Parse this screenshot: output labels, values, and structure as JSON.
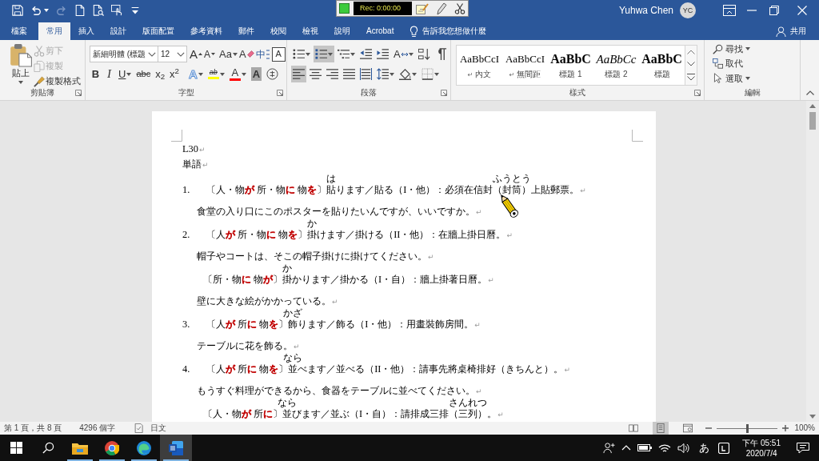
{
  "title_bar": {
    "quick_access": [
      {
        "kind": "save",
        "disabled": false
      },
      {
        "kind": "undo",
        "disabled": false,
        "dropdown": true
      },
      {
        "kind": "redo",
        "disabled": true
      },
      {
        "kind": "new",
        "disabled": false
      },
      {
        "kind": "preview",
        "disabled": false
      },
      {
        "kind": "touch",
        "disabled": false
      },
      {
        "kind": "customize",
        "disabled": false
      }
    ],
    "recorder": {
      "time": "Rec: 0:00:00"
    },
    "user": {
      "name": "Yuhwa Chen",
      "initials": "YC"
    }
  },
  "tabs": [
    {
      "label": "檔案",
      "selected": false
    },
    {
      "label": "常用",
      "selected": true
    },
    {
      "label": "插入",
      "selected": false
    },
    {
      "label": "設計",
      "selected": false
    },
    {
      "label": "版面配置",
      "selected": false
    },
    {
      "label": "參考資料",
      "selected": false
    },
    {
      "label": "郵件",
      "selected": false
    },
    {
      "label": "校閱",
      "selected": false
    },
    {
      "label": "檢視",
      "selected": false
    },
    {
      "label": "說明",
      "selected": false
    },
    {
      "label": "Acrobat",
      "selected": false
    }
  ],
  "tell_me": {
    "placeholder": "告訴我您想做什麼"
  },
  "share": {
    "label": "共用"
  },
  "ribbon": {
    "clipboard": {
      "title": "剪貼簿",
      "paste": "貼上",
      "items": [
        {
          "kind": "cut",
          "label": "剪下",
          "disabled": true
        },
        {
          "kind": "copy",
          "label": "複製",
          "disabled": true
        },
        {
          "kind": "format_painter",
          "label": "複製格式",
          "disabled": false
        }
      ]
    },
    "font": {
      "title": "字型",
      "font_name": "新細明體 (標題",
      "font_size": "12",
      "row_1": [
        {
          "kind": "grow",
          "text": "A"
        },
        {
          "kind": "shrink",
          "text": "A"
        },
        {
          "kind": "change_case",
          "text": "Aa",
          "dropdown": true
        },
        {
          "kind": "clear_format",
          "text": "A"
        },
        {
          "kind": "phonetic",
          "text": "中"
        },
        {
          "kind": "char_border",
          "text": "A"
        }
      ],
      "row_2": [
        {
          "kind": "bold",
          "text": "B"
        },
        {
          "kind": "italic",
          "text": "I"
        },
        {
          "kind": "underline",
          "text": "U",
          "dropdown": true
        },
        {
          "kind": "strike",
          "text": "abc"
        },
        {
          "kind": "subscript",
          "text": "x$_{2}$"
        },
        {
          "kind": "superscript",
          "text": "x$^{2}$"
        },
        {
          "kind": "text_effects",
          "text": "A",
          "dropdown": true
        },
        {
          "kind": "highlight",
          "text": "ab",
          "color": "#ffff00",
          "dropdown": true
        },
        {
          "kind": "font_color",
          "text": "A",
          "color": "#ff0000",
          "dropdown": true
        },
        {
          "kind": "char_shading",
          "text": "A"
        },
        {
          "kind": "enclosed"
        }
      ]
    },
    "paragraph": {
      "title": "段落",
      "row_1": [
        {
          "kind": "bullets",
          "on": false,
          "dropdown": true
        },
        {
          "kind": "numbering",
          "on": true,
          "dropdown": true
        },
        {
          "kind": "multilevel",
          "on": false,
          "dropdown": true
        },
        {
          "kind": "outdent",
          "on": false
        },
        {
          "kind": "indent",
          "on": false
        },
        {
          "kind": "asian_layout",
          "text": "A",
          "on": false,
          "dropdown": true
        },
        {
          "kind": "sort",
          "on": false
        },
        {
          "kind": "show_marks",
          "on": false
        }
      ],
      "row_2": [
        {
          "kind": "align_left",
          "on": true
        },
        {
          "kind": "align_center",
          "on": false
        },
        {
          "kind": "align_right",
          "on": false
        },
        {
          "kind": "justify",
          "on": false
        },
        {
          "kind": "distribute",
          "on": false
        },
        {
          "kind": "line_spacing",
          "on": false,
          "dropdown": true
        },
        {
          "kind": "shading",
          "on": false,
          "dropdown": true
        },
        {
          "kind": "borders",
          "on": false,
          "dropdown": true
        }
      ]
    },
    "styles": {
      "title": "樣式",
      "items": [
        {
          "kind": "normal",
          "preview": "AaBbCcI",
          "mark": "↵",
          "name": "內文"
        },
        {
          "kind": "normal",
          "preview": "AaBbCcI",
          "mark": "↵",
          "name": "無間距"
        },
        {
          "kind": "heading",
          "preview": "AaBbC",
          "name": "標題 1"
        },
        {
          "kind": "heading_italic",
          "preview": "AaBbCc",
          "name": "標題 2"
        },
        {
          "kind": "heading",
          "preview": "AaBbC",
          "name": "標題"
        }
      ]
    },
    "editing": {
      "title": "編輯",
      "items": [
        {
          "kind": "find",
          "label": "尋找",
          "dropdown": true
        },
        {
          "kind": "replace",
          "label": "取代"
        },
        {
          "kind": "select",
          "label": "選取",
          "dropdown": true
        }
      ]
    }
  },
  "document": {
    "paragraphs": [
      {
        "kind": "plain",
        "segments": [
          {
            "kind": "text",
            "text": "L30"
          }
        ],
        "end_mark": "↵"
      },
      {
        "kind": "plain",
        "segments": [
          {
            "kind": "text",
            "text": "単語"
          }
        ],
        "end_mark": "↵"
      },
      {
        "kind": "item",
        "number": "1.",
        "segments": [
          {
            "kind": "text",
            "text": "〔人・物"
          },
          {
            "kind": "text",
            "text": "が",
            "color": "#c00000"
          },
          {
            "kind": "text",
            "text": " 所・物"
          },
          {
            "kind": "text",
            "text": "に",
            "color": "#c00000"
          },
          {
            "kind": "text",
            "text": " 物"
          },
          {
            "kind": "text",
            "text": "を",
            "color": "#c00000"
          },
          {
            "kind": "text",
            "text": "〕"
          },
          {
            "kind": "ruby",
            "text": "貼",
            "ruby": "は"
          },
          {
            "kind": "text",
            "text": "ります／貼る（I・他）：必須在信封（"
          },
          {
            "kind": "ruby",
            "text": "封筒",
            "ruby": "ふうとう"
          },
          {
            "kind": "text",
            "text": "）上貼郵票。"
          }
        ],
        "end_mark": "↵"
      },
      {
        "kind": "example",
        "segments": [
          {
            "kind": "text",
            "text": "食堂の入り口にこのポスターを貼りたいんですが、いいですか。"
          }
        ],
        "end_mark": "↵"
      },
      {
        "kind": "item",
        "number": "2.",
        "segments": [
          {
            "kind": "text",
            "text": "〔人"
          },
          {
            "kind": "text",
            "text": "が",
            "color": "#c00000"
          },
          {
            "kind": "text",
            "text": " 所・物"
          },
          {
            "kind": "text",
            "text": "に",
            "color": "#c00000"
          },
          {
            "kind": "text",
            "text": " 物"
          },
          {
            "kind": "text",
            "text": "を",
            "color": "#c00000"
          },
          {
            "kind": "text",
            "text": "〕"
          },
          {
            "kind": "ruby",
            "text": "掛",
            "ruby": "か"
          },
          {
            "kind": "text",
            "text": "けます／掛ける（II・他）：在牆上掛日曆。"
          }
        ],
        "end_mark": "↵"
      },
      {
        "kind": "example",
        "segments": [
          {
            "kind": "text",
            "text": "帽子やコートは、そこの帽子掛けに掛けてください。"
          }
        ],
        "end_mark": "↵"
      },
      {
        "kind": "subitem",
        "segments": [
          {
            "kind": "text",
            "text": "〔所・物"
          },
          {
            "kind": "text",
            "text": "に",
            "color": "#c00000"
          },
          {
            "kind": "text",
            "text": " 物"
          },
          {
            "kind": "text",
            "text": "が",
            "color": "#c00000"
          },
          {
            "kind": "text",
            "text": "〕"
          },
          {
            "kind": "ruby",
            "text": "掛",
            "ruby": "か"
          },
          {
            "kind": "text",
            "text": "かります／掛かる（I・自）：牆上掛著日曆。"
          }
        ],
        "end_mark": "↵"
      },
      {
        "kind": "example",
        "segments": [
          {
            "kind": "text",
            "text": "壁に大きな絵がかかっている。"
          }
        ],
        "end_mark": "↵"
      },
      {
        "kind": "item",
        "number": "3.",
        "segments": [
          {
            "kind": "text",
            "text": "〔人"
          },
          {
            "kind": "text",
            "text": "が",
            "color": "#c00000"
          },
          {
            "kind": "text",
            "text": " 所"
          },
          {
            "kind": "text",
            "text": "に",
            "color": "#c00000"
          },
          {
            "kind": "text",
            "text": " 物"
          },
          {
            "kind": "text",
            "text": "を",
            "color": "#c00000"
          },
          {
            "kind": "text",
            "text": "〕"
          },
          {
            "kind": "ruby",
            "text": "飾",
            "ruby": "かざ"
          },
          {
            "kind": "text",
            "text": "ります／飾る（I・他）：用畫裝飾房間。"
          }
        ],
        "end_mark": "↵"
      },
      {
        "kind": "example",
        "segments": [
          {
            "kind": "text",
            "text": "テーブルに花を飾る。"
          }
        ],
        "end_mark": "↵"
      },
      {
        "kind": "item",
        "number": "4.",
        "segments": [
          {
            "kind": "text",
            "text": "〔人"
          },
          {
            "kind": "text",
            "text": "が",
            "color": "#c00000"
          },
          {
            "kind": "text",
            "text": " 所"
          },
          {
            "kind": "text",
            "text": "に",
            "color": "#c00000"
          },
          {
            "kind": "text",
            "text": " 物"
          },
          {
            "kind": "text",
            "text": "を",
            "color": "#c00000"
          },
          {
            "kind": "text",
            "text": "〕"
          },
          {
            "kind": "ruby",
            "text": "並",
            "ruby": "なら"
          },
          {
            "kind": "text",
            "text": "べます／並べる（II・他）：請事先將桌椅排好（きちんと）。"
          }
        ],
        "end_mark": "↵"
      },
      {
        "kind": "example",
        "segments": [
          {
            "kind": "text",
            "text": "もうすぐ料理ができるから、食器をテーブルに並べてください。"
          }
        ],
        "end_mark": "↵"
      },
      {
        "kind": "subitem",
        "segments": [
          {
            "kind": "text",
            "text": "〔人・物"
          },
          {
            "kind": "text",
            "text": "が",
            "color": "#c00000"
          },
          {
            "kind": "text",
            "text": " 所"
          },
          {
            "kind": "text",
            "text": "に",
            "color": "#c00000"
          },
          {
            "kind": "text",
            "text": "〕"
          },
          {
            "kind": "ruby",
            "text": "並",
            "ruby": "なら"
          },
          {
            "kind": "text",
            "text": "びます／並ぶ（I・自）：請排成三排（"
          },
          {
            "kind": "ruby",
            "text": "三列",
            "ruby": "さんれつ"
          },
          {
            "kind": "text",
            "text": "）。"
          }
        ],
        "end_mark": "↵"
      }
    ]
  },
  "status_bar": {
    "page": "第 1 頁，共 8 頁",
    "words": "4296 個字",
    "language": "日文",
    "views": [
      {
        "kind": "read",
        "selected": false
      },
      {
        "kind": "print",
        "selected": true
      },
      {
        "kind": "web",
        "selected": false
      }
    ],
    "zoom": {
      "level": 0.5,
      "label": "100%"
    }
  },
  "taskbar": {
    "apps": [
      {
        "kind": "explorer",
        "running": true,
        "active": false
      },
      {
        "kind": "chrome",
        "running": true,
        "active": false
      },
      {
        "kind": "edge",
        "running": true,
        "active": false
      },
      {
        "kind": "word",
        "running": true,
        "active": true
      }
    ],
    "ime": "あ",
    "time": "下午 05:51",
    "date": "2020/7/4"
  }
}
